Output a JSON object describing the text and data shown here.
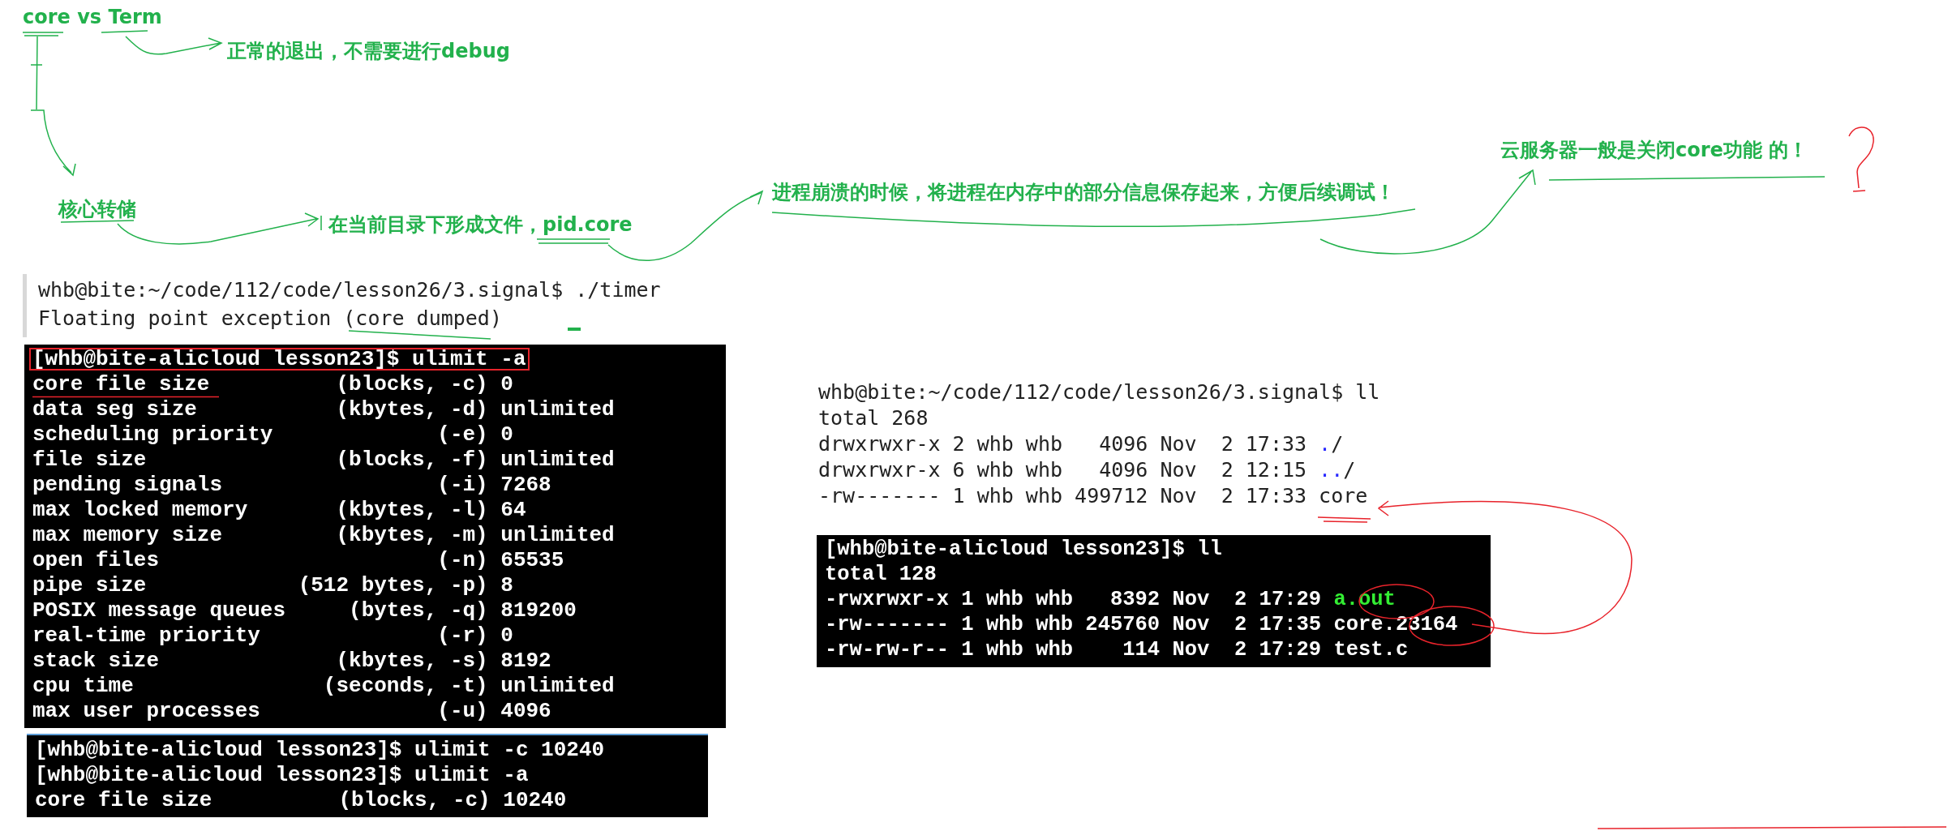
{
  "notes": [
    {
      "text": "core vs Term"
    },
    {
      "text": "正常的退出，不需要进行debug"
    },
    {
      "text": "核心转储"
    },
    {
      "text": "在当前目录下形成文件，pid.core"
    },
    {
      "text": "进程崩溃的时候，将进程在内存中的部分信息保存起来，方便后续调试！"
    },
    {
      "text": "云服务器一般是关闭core功能 的！"
    }
  ],
  "terminals": [
    {
      "kind": "plain",
      "lines": [
        {
          "highlighted": false,
          "segments": [
            {
              "text": "whb@bite:~/code/112/code/lesson26/3.signal$ ./timer"
            }
          ]
        },
        {
          "highlighted": false,
          "segments": [
            {
              "text": "Floating point exception (core dumped)"
            }
          ]
        }
      ]
    },
    {
      "kind": "dark",
      "lines": [
        {
          "highlighted": true,
          "segments": [
            {
              "text": "[whb@bite-alicloud lesson23]$ ulimit -a"
            }
          ]
        },
        {
          "highlighted": false,
          "segments": [
            {
              "text": "core file size          (blocks, -c) 0"
            }
          ]
        },
        {
          "highlighted": false,
          "segments": [
            {
              "text": "data seg size           (kbytes, -d) unlimited"
            }
          ]
        },
        {
          "highlighted": false,
          "segments": [
            {
              "text": "scheduling priority             (-e) 0"
            }
          ]
        },
        {
          "highlighted": false,
          "segments": [
            {
              "text": "file size               (blocks, -f) unlimited"
            }
          ]
        },
        {
          "highlighted": false,
          "segments": [
            {
              "text": "pending signals                 (-i) 7268"
            }
          ]
        },
        {
          "highlighted": false,
          "segments": [
            {
              "text": "max locked memory       (kbytes, -l) 64"
            }
          ]
        },
        {
          "highlighted": false,
          "segments": [
            {
              "text": "max memory size         (kbytes, -m) unlimited"
            }
          ]
        },
        {
          "highlighted": false,
          "segments": [
            {
              "text": "open files                      (-n) 65535"
            }
          ]
        },
        {
          "highlighted": false,
          "segments": [
            {
              "text": "pipe size            (512 bytes, -p) 8"
            }
          ]
        },
        {
          "highlighted": false,
          "segments": [
            {
              "text": "POSIX message queues     (bytes, -q) 819200"
            }
          ]
        },
        {
          "highlighted": false,
          "segments": [
            {
              "text": "real-time priority              (-r) 0"
            }
          ]
        },
        {
          "highlighted": false,
          "segments": [
            {
              "text": "stack size              (kbytes, -s) 8192"
            }
          ]
        },
        {
          "highlighted": false,
          "segments": [
            {
              "text": "cpu time               (seconds, -t) unlimited"
            }
          ]
        },
        {
          "highlighted": false,
          "segments": [
            {
              "text": "max user processes              (-u) 4096"
            }
          ]
        }
      ]
    },
    {
      "kind": "dark",
      "lines": [
        {
          "highlighted": false,
          "segments": [
            {
              "text": "[whb@bite-alicloud lesson23]$ ulimit -c 10240"
            }
          ]
        },
        {
          "highlighted": false,
          "segments": [
            {
              "text": "[whb@bite-alicloud lesson23]$ ulimit -a"
            }
          ]
        },
        {
          "highlighted": false,
          "segments": [
            {
              "text": "core file size          (blocks, -c) 10240"
            }
          ]
        }
      ]
    },
    {
      "kind": "plain",
      "lines": [
        {
          "highlighted": false,
          "segments": [
            {
              "text": "whb@bite:~/code/112/code/lesson26/3.signal$ ll"
            }
          ]
        },
        {
          "highlighted": false,
          "segments": [
            {
              "text": "total 268"
            }
          ]
        },
        {
          "highlighted": false,
          "segments": [
            {
              "text": "drwxrwxr-x 2 whb whb   4096 Nov  2 17:33 "
            },
            {
              "text": ".",
              "color": "#2a2aff"
            },
            {
              "text": "/"
            }
          ]
        },
        {
          "highlighted": false,
          "segments": [
            {
              "text": "drwxrwxr-x 6 whb whb   4096 Nov  2 12:15 "
            },
            {
              "text": "..",
              "color": "#2a2aff"
            },
            {
              "text": "/"
            }
          ]
        },
        {
          "highlighted": false,
          "segments": [
            {
              "text": "-rw------- 1 whb whb 499712 Nov  2 17:33 core"
            }
          ]
        }
      ]
    },
    {
      "kind": "dark",
      "lines": [
        {
          "highlighted": false,
          "segments": [
            {
              "text": "[whb@bite-alicloud lesson23]$ ll"
            }
          ]
        },
        {
          "highlighted": false,
          "segments": [
            {
              "text": "total 128"
            }
          ]
        },
        {
          "highlighted": false,
          "segments": [
            {
              "text": "-rwxrwxr-x 1 whb whb   8392 Nov  2 17:29 "
            },
            {
              "text": "a.out",
              "color": "#33ee33"
            }
          ]
        },
        {
          "highlighted": false,
          "segments": [
            {
              "text": "-rw------- 1 whb whb 245760 Nov  2 17:35 core.23164"
            }
          ]
        },
        {
          "highlighted": false,
          "segments": [
            {
              "text": "-rw-rw-r-- 1 whb whb    114 Nov  2 17:29 test.c"
            }
          ]
        }
      ]
    }
  ]
}
